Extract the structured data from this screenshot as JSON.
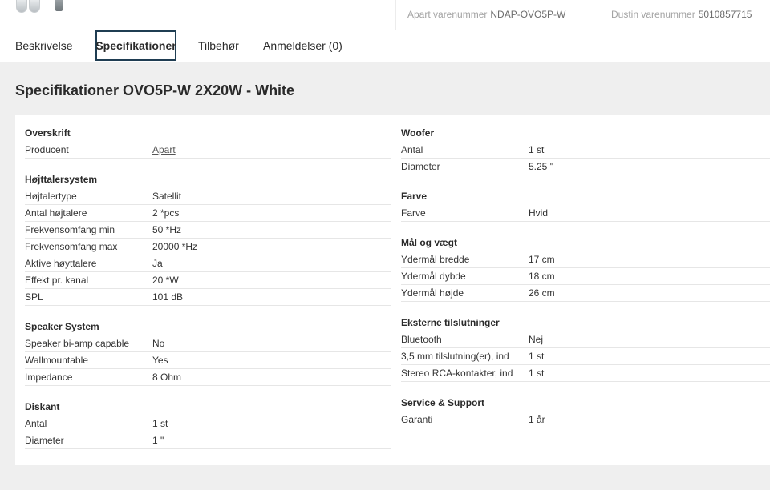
{
  "header": {
    "apart_label": "Apart varenummer",
    "apart_value": "NDAP-OVO5P-W",
    "dustin_label": "Dustin varenummer",
    "dustin_value": "5010857715"
  },
  "tabs": [
    {
      "label": "Beskrivelse"
    },
    {
      "label": "Specifikationer"
    },
    {
      "label": "Tilbehør"
    },
    {
      "label": "Anmeldelser (0)"
    }
  ],
  "page_title": "Specifikationer OVO5P-W 2X20W - White",
  "left_groups": [
    {
      "title": "Overskrift",
      "rows": [
        {
          "k": "Producent",
          "v": "Apart"
        }
      ]
    },
    {
      "title": "Højttalersystem",
      "rows": [
        {
          "k": "Højtalertype",
          "v": "Satellit"
        },
        {
          "k": "Antal højtalere",
          "v": "2 *pcs"
        },
        {
          "k": "Frekvensomfang min",
          "v": "50 *Hz"
        },
        {
          "k": "Frekvensomfang max",
          "v": "20000 *Hz"
        },
        {
          "k": "Aktive høyttalere",
          "v": "Ja"
        },
        {
          "k": "Effekt pr. kanal",
          "v": "20 *W"
        },
        {
          "k": "SPL",
          "v": "101 dB"
        }
      ]
    },
    {
      "title": "Speaker System",
      "rows": [
        {
          "k": "Speaker bi-amp capable",
          "v": "No"
        },
        {
          "k": "Wallmountable",
          "v": "Yes"
        },
        {
          "k": "Impedance",
          "v": "8 Ohm"
        }
      ]
    },
    {
      "title": "Diskant",
      "rows": [
        {
          "k": "Antal",
          "v": "1 st"
        },
        {
          "k": "Diameter",
          "v": "1 \""
        }
      ]
    }
  ],
  "right_groups": [
    {
      "title": "Woofer",
      "rows": [
        {
          "k": "Antal",
          "v": "1 st"
        },
        {
          "k": "Diameter",
          "v": "5.25 \""
        }
      ]
    },
    {
      "title": "Farve",
      "rows": [
        {
          "k": "Farve",
          "v": "Hvid"
        }
      ]
    },
    {
      "title": "Mål og vægt",
      "rows": [
        {
          "k": "Ydermål bredde",
          "v": "17 cm"
        },
        {
          "k": "Ydermål dybde",
          "v": "18 cm"
        },
        {
          "k": "Ydermål højde",
          "v": "26 cm"
        }
      ]
    },
    {
      "title": "Eksterne tilslutninger",
      "rows": [
        {
          "k": "Bluetooth",
          "v": "Nej"
        },
        {
          "k": "3,5 mm tilslutning(er), ind",
          "v": "1 st"
        },
        {
          "k": "Stereo RCA-kontakter, ind",
          "v": "1 st"
        }
      ]
    },
    {
      "title": "Service & Support",
      "rows": [
        {
          "k": "Garanti",
          "v": "1 år"
        }
      ]
    }
  ]
}
